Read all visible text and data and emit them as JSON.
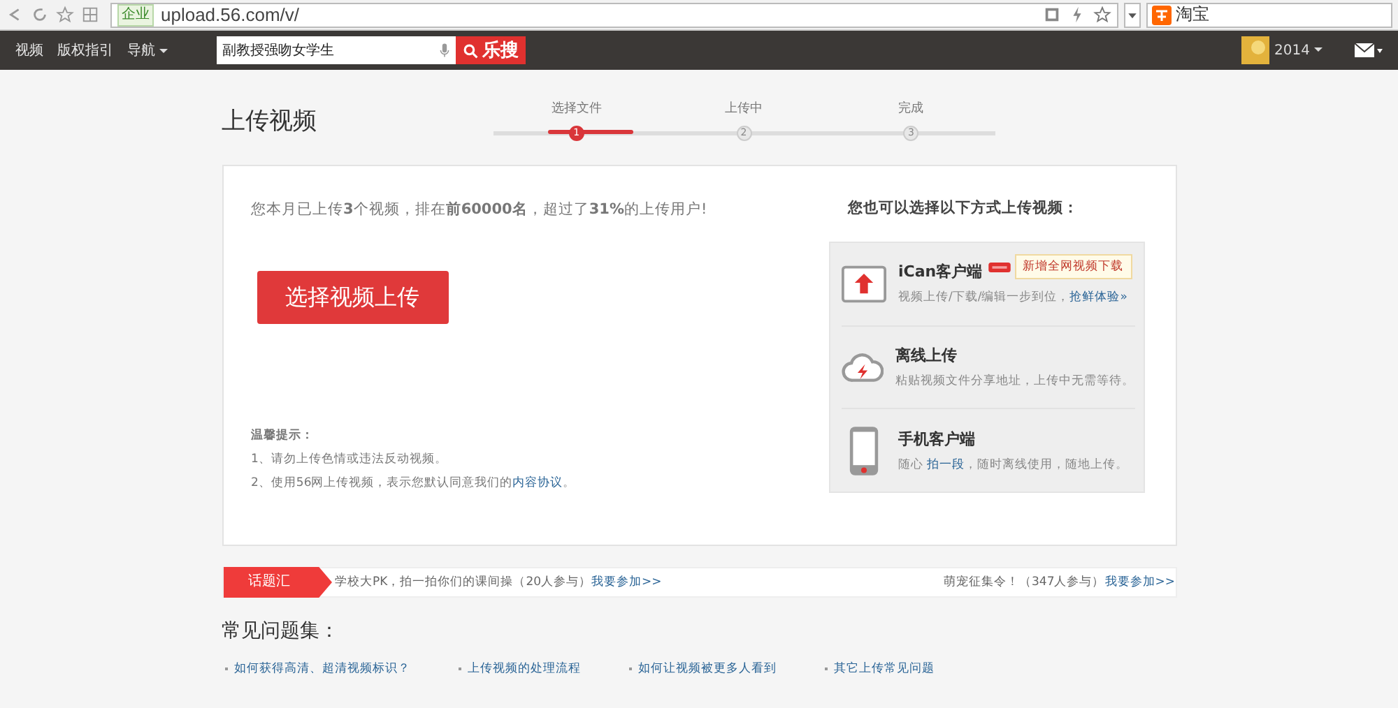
{
  "browser": {
    "badge": "企业",
    "url": "upload.56.com/v/",
    "search_engine": "淘宝"
  },
  "nav": {
    "items": [
      {
        "label": "视频",
        "dropdown": false
      },
      {
        "label": "版权指引",
        "dropdown": false
      },
      {
        "label": "导航",
        "dropdown": true
      }
    ],
    "search_value": "副教授强吻女学生",
    "search_button": "乐搜",
    "year": "2014"
  },
  "page_title": "上传视频",
  "steps": [
    {
      "label": "选择文件",
      "number": "1",
      "selected": true
    },
    {
      "label": "上传中",
      "number": "2",
      "selected": false
    },
    {
      "label": "完成",
      "number": "3",
      "selected": false
    }
  ],
  "stats": "您本月已上传**3**个视频，排在**前60000名**，超过了**31%**的上传用户!",
  "upload_button": "选择视频上传",
  "tips": {
    "title": "温馨提示：",
    "lines": [
      [
        {
          "text": "1、请勿上传色情或违法反动视频。",
          "link": false
        }
      ],
      [
        {
          "text": "2、使用56网上传视频，表示您默认同意我们的",
          "link": false
        },
        {
          "text": "内容协议",
          "link": true
        },
        {
          "text": "。",
          "link": false
        }
      ]
    ]
  },
  "options_title": "您也可以选择以下方式上传视频：",
  "options": [
    {
      "kind": "ican",
      "name": "iCan客户端",
      "new": true,
      "tooltip": "新增全网视频下载",
      "desc": [
        {
          "text": "视频上传/下载/编辑一步到位，",
          "link": false
        },
        {
          "text": "抢鲜体验»",
          "link": true
        }
      ]
    },
    {
      "kind": "offline",
      "name": "离线上传",
      "new": false,
      "desc": [
        {
          "text": "粘贴视频文件分享地址，上传中无需等待。",
          "link": false
        }
      ]
    },
    {
      "kind": "mobile",
      "name": "手机客户端",
      "new": false,
      "desc": [
        {
          "text": "随心 ",
          "link": false
        },
        {
          "text": "拍一段",
          "link": true
        },
        {
          "text": "，随时离线使用，随地上传。",
          "link": false
        }
      ]
    }
  ],
  "topics": {
    "label": "话题汇",
    "items": [
      {
        "text": "学校大PK，拍一拍你们的课间操（20人参与）",
        "link": "我要参加>>"
      },
      {
        "text": "萌宠征集令！（347人参与）",
        "link": "我要参加>>"
      }
    ]
  },
  "faq": {
    "title": "常见问题集：",
    "items": [
      "如何获得高清、超清视频标识？",
      "上传视频的处理流程",
      "如何让视频被更多人看到",
      "其它上传常见问题"
    ]
  }
}
